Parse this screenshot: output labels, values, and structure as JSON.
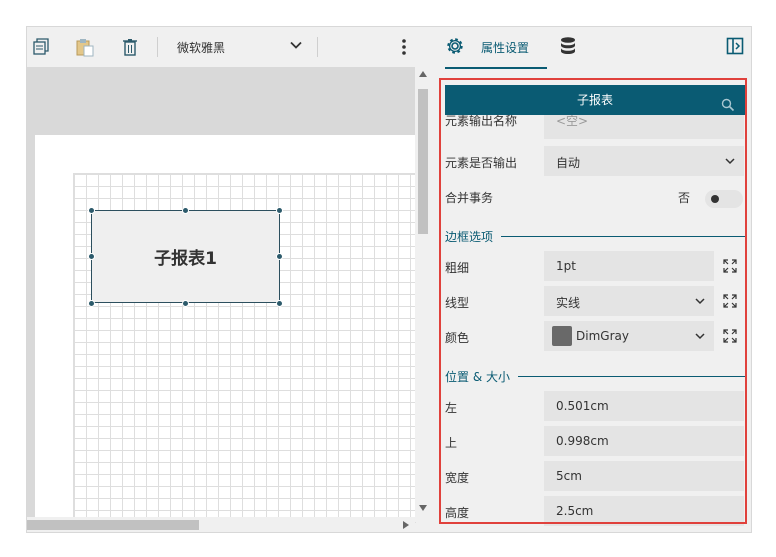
{
  "toolbar": {
    "font_name": "微软雅黑",
    "icons": [
      "copy-icon",
      "paste-icon",
      "delete-icon",
      "chevron-down-icon",
      "more-vertical-icon"
    ]
  },
  "canvas": {
    "subreport_label": "子报表1"
  },
  "panel": {
    "tabs": [
      {
        "label": "属性设置",
        "icon": "gear-icon",
        "active": true
      },
      {
        "label": "",
        "icon": "database-icon",
        "active": false
      }
    ],
    "collapse_icon": "panel-collapse-icon",
    "search_title": "子报表",
    "partial_row": {
      "label": "元素输出名称",
      "value": "<空>"
    },
    "rows_top": [
      {
        "label": "元素是否输出",
        "value": "自动"
      },
      {
        "label": "合并事务",
        "value": "否"
      }
    ],
    "border_section": {
      "title": "边框选项",
      "thickness": {
        "label": "粗细",
        "value": "1pt"
      },
      "line_type": {
        "label": "线型",
        "value": "实线"
      },
      "color": {
        "label": "颜色",
        "value": "DimGray",
        "swatch": "#696969"
      }
    },
    "position_section": {
      "title": "位置 & 大小",
      "left": {
        "label": "左",
        "value": "0.501cm"
      },
      "top": {
        "label": "上",
        "value": "0.998cm"
      },
      "width": {
        "label": "宽度",
        "value": "5cm"
      },
      "height": {
        "label": "高度",
        "value": "2.5cm"
      }
    }
  },
  "colors": {
    "accent": "#0a5b73",
    "highlight_border": "#e0413c"
  }
}
